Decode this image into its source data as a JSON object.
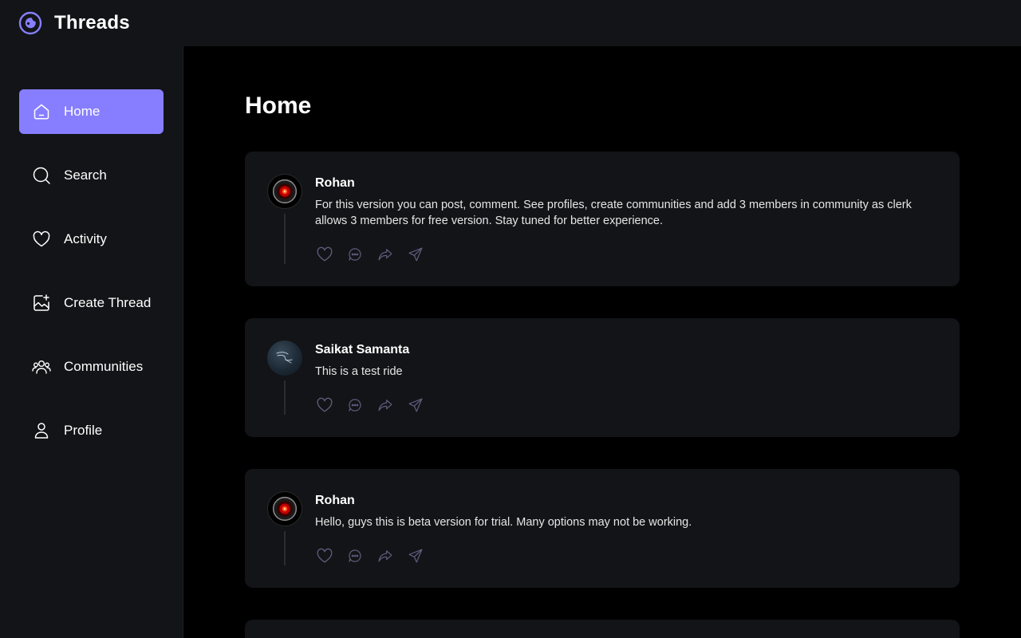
{
  "app": {
    "title": "Threads"
  },
  "sidebar": {
    "items": [
      {
        "label": "Home",
        "icon": "home-icon",
        "active": true
      },
      {
        "label": "Search",
        "icon": "search-icon"
      },
      {
        "label": "Activity",
        "icon": "heart-icon"
      },
      {
        "label": "Create Thread",
        "icon": "image-plus-icon"
      },
      {
        "label": "Communities",
        "icon": "users-icon"
      },
      {
        "label": "Profile",
        "icon": "user-icon"
      }
    ]
  },
  "main": {
    "title": "Home",
    "threads": [
      {
        "author": "Rohan",
        "avatar": "hal-avatar",
        "text": "For this version you can post, comment. See profiles, create communities and add 3 members in community as clerk allows 3 members for free version. Stay tuned for better experience."
      },
      {
        "author": "Saikat Samanta",
        "avatar": "kali-avatar",
        "text": "This is a test ride"
      },
      {
        "author": "Rohan",
        "avatar": "hal-avatar",
        "text": "Hello, guys this is beta version for trial. Many options may not be working."
      }
    ],
    "actions": [
      "heart-icon",
      "reply-icon",
      "repost-icon",
      "share-icon"
    ]
  },
  "colors": {
    "accent": "#877eff",
    "panel": "#121417",
    "background": "#000000",
    "icon_muted": "#5c5c7b"
  }
}
